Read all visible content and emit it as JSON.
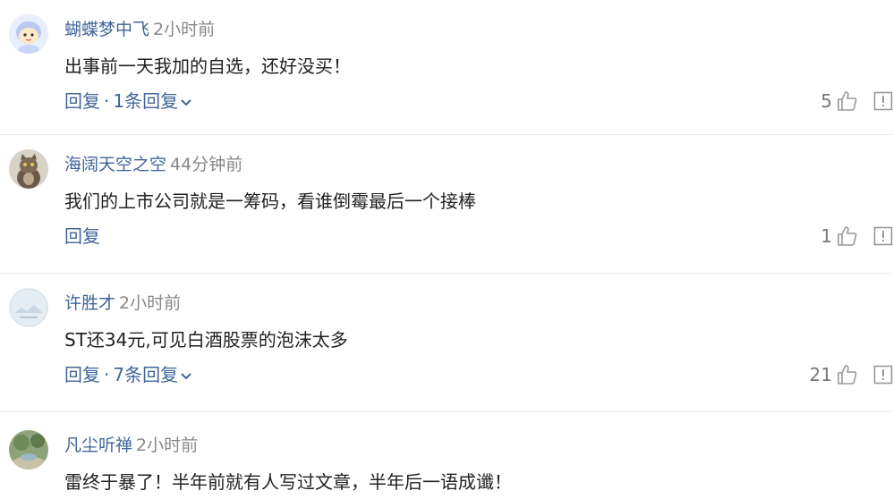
{
  "comments": [
    {
      "user": "蝴蝶梦中飞",
      "time": "2小时前",
      "text": "出事前一天我加的自选，还好没买！",
      "reply_label": "回复",
      "sep": "·",
      "replies_label": "1条回复",
      "likes": "5",
      "avatar_icon": "cartoon-avatar",
      "has_replies": true
    },
    {
      "user": "海阔天空之空",
      "time": "44分钟前",
      "text": "我们的上市公司就是一筹码，看谁倒霉最后一个接棒",
      "reply_label": "回复",
      "likes": "1",
      "avatar_icon": "cat-avatar",
      "has_replies": false
    },
    {
      "user": "许胜才",
      "time": "2小时前",
      "text": "ST还34元,可见白酒股票的泡沫太多",
      "reply_label": "回复",
      "sep": "·",
      "replies_label": "7条回复",
      "likes": "21",
      "avatar_icon": "landscape-avatar",
      "has_replies": true
    },
    {
      "user": "凡尘听禅",
      "time": "2小时前",
      "text": "雷终于暴了！半年前就有人写过文章，半年后一语成谶！",
      "avatar_icon": "garden-avatar",
      "has_replies": false
    }
  ],
  "colors": {
    "link": "#406599",
    "meta": "#888888",
    "text": "#222222"
  }
}
